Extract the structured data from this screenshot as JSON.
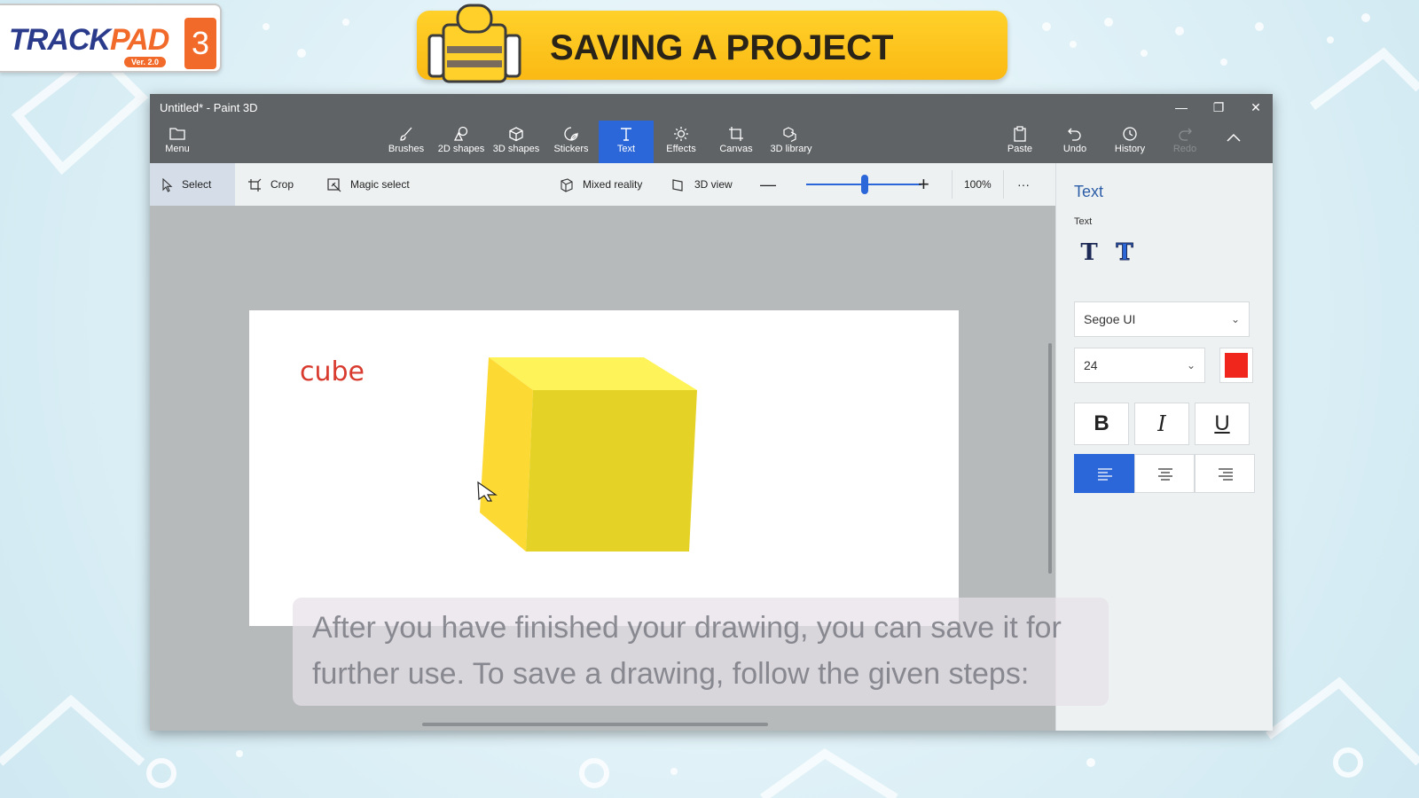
{
  "brand": {
    "name_part1": "TRACK",
    "name_part2": "PAD",
    "version": "Ver. 2.0",
    "number": "3"
  },
  "banner": {
    "title": "SAVING A PROJECT"
  },
  "window": {
    "title": "Untitled* - Paint 3D"
  },
  "ribbon": {
    "menu": "Menu",
    "tools": [
      {
        "label": "Brushes",
        "icon": "brush-icon"
      },
      {
        "label": "2D shapes",
        "icon": "2d-shapes-icon"
      },
      {
        "label": "3D shapes",
        "icon": "3d-shapes-icon"
      },
      {
        "label": "Stickers",
        "icon": "sticker-icon"
      },
      {
        "label": "Text",
        "icon": "text-icon",
        "active": true
      },
      {
        "label": "Effects",
        "icon": "effects-icon"
      },
      {
        "label": "Canvas",
        "icon": "canvas-icon"
      },
      {
        "label": "3D library",
        "icon": "3d-library-icon"
      }
    ],
    "paste": "Paste",
    "undo": "Undo",
    "history": "History",
    "redo": "Redo"
  },
  "toolbar": {
    "select": "Select",
    "crop": "Crop",
    "magic_select": "Magic select",
    "mixed_reality": "Mixed reality",
    "view_3d": "3D view",
    "zoom_level": "100%",
    "more": "···"
  },
  "canvas": {
    "text": "cube",
    "text_color": "#d83a2e"
  },
  "caption": {
    "line1": "After you have finished your drawing, you can save it for",
    "line2": "further use. To save a drawing, follow the given steps:"
  },
  "panel": {
    "title": "Text",
    "subtitle": "Text",
    "font": "Segoe UI",
    "size": "24",
    "color": "#f0261c",
    "bold": "B",
    "italic": "I",
    "underline": "U"
  },
  "colors": {
    "accent": "#2b67d8",
    "ribbon": "#5f6366",
    "banner": "#fbbf18"
  }
}
